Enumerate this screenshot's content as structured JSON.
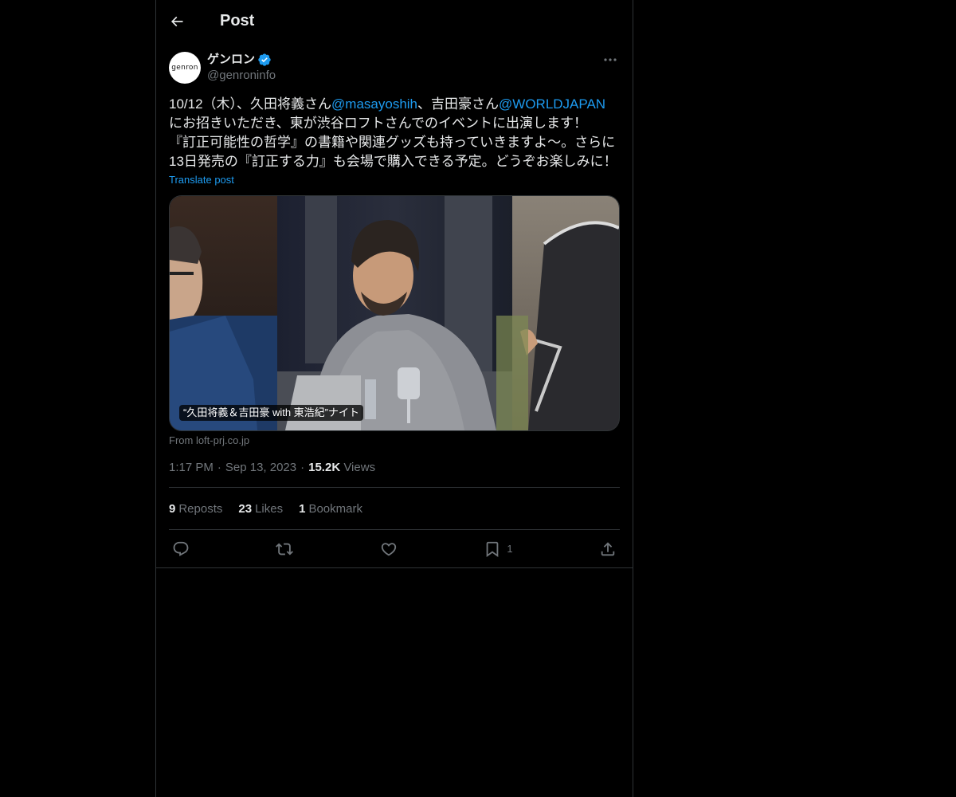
{
  "header": {
    "title": "Post"
  },
  "post": {
    "author": {
      "display_name": "ゲンロン",
      "handle": "@genroninfo",
      "avatar_text": "genron",
      "verified": true
    },
    "text": {
      "line1_a": "10/12（木）、久田将義さん",
      "mention1": "@masayoshih",
      "line1_b": "、吉田豪さん",
      "mention2": "@WORLDJAPAN",
      "line2": "にお招きいただき、東が渋谷ロフトさんでのイベントに出演します！",
      "line3": "『訂正可能性の哲学』の書籍や関連グッズも持っていきますよ〜。さらに",
      "line4": "13日発売の『訂正する力』も会場で購入できる予定。どうぞお楽しみに！"
    },
    "translate_label": "Translate post",
    "card": {
      "caption": "“久田将義＆吉田豪 with 東浩紀”ナイト",
      "from_label": "From loft-prj.co.jp"
    },
    "meta": {
      "time": "1:17 PM",
      "date": "Sep 13, 2023",
      "views_count": "15.2K",
      "views_label": "Views"
    },
    "stats": {
      "reposts_count": "9",
      "reposts_label": "Reposts",
      "likes_count": "23",
      "likes_label": "Likes",
      "bookmarks_count": "1",
      "bookmarks_label": "Bookmark"
    },
    "actions": {
      "bookmark_count": "1"
    }
  },
  "colors": {
    "background": "#000000",
    "text": "#e7e9ea",
    "muted": "#71767b",
    "accent": "#1d9bf0",
    "border": "#2f3336"
  }
}
